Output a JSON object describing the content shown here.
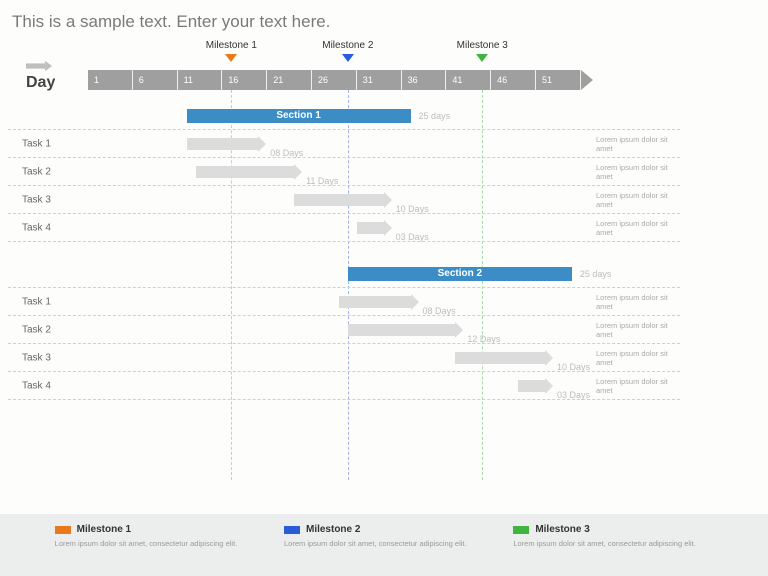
{
  "title": "This is a sample text. Enter your text here.",
  "day_label": "Day",
  "axis_ticks": [
    "1",
    "6",
    "11",
    "16",
    "21",
    "26",
    "31",
    "36",
    "41",
    "46",
    "51"
  ],
  "milestones": [
    {
      "label": "Milestone 1",
      "day": 17,
      "color": "#e87a1c"
    },
    {
      "label": "Milestone 2",
      "day": 30,
      "color": "#2a5bd8"
    },
    {
      "label": "Milestone 3",
      "day": 45,
      "color": "#3fb540"
    }
  ],
  "sections": [
    {
      "name": "Section 1",
      "start": 12,
      "duration": 25,
      "duration_label": "25 days",
      "tasks": [
        {
          "name": "Task 1",
          "start": 12,
          "duration": 8,
          "dur_label": "08 Days",
          "note": "Lorem ipsum dolor sit amet"
        },
        {
          "name": "Task 2",
          "start": 13,
          "duration": 11,
          "dur_label": "11 Days",
          "note": "Lorem ipsum dolor sit amet"
        },
        {
          "name": "Task 3",
          "start": 24,
          "duration": 10,
          "dur_label": "10 Days",
          "note": "Lorem ipsum dolor sit amet"
        },
        {
          "name": "Task 4",
          "start": 31,
          "duration": 3,
          "dur_label": "03 Days",
          "note": "Lorem ipsum dolor sit amet"
        }
      ]
    },
    {
      "name": "Section 2",
      "start": 30,
      "duration": 25,
      "duration_label": "25 days",
      "tasks": [
        {
          "name": "Task 1",
          "start": 29,
          "duration": 8,
          "dur_label": "08 Days",
          "note": "Lorem ipsum dolor sit amet"
        },
        {
          "name": "Task 2",
          "start": 30,
          "duration": 12,
          "dur_label": "12 Days",
          "note": "Lorem ipsum dolor sit amet"
        },
        {
          "name": "Task 3",
          "start": 42,
          "duration": 10,
          "dur_label": "10 Days",
          "note": "Lorem ipsum dolor sit amet"
        },
        {
          "name": "Task 4",
          "start": 49,
          "duration": 3,
          "dur_label": "03 Days",
          "note": "Lorem ipsum dolor sit amet"
        }
      ]
    }
  ],
  "legend": [
    {
      "name": "Milestone 1",
      "color": "#e87a1c",
      "desc": "Lorem ipsum dolor sit amet, consectetur adipiscing elit."
    },
    {
      "name": "Milestone 2",
      "color": "#2a5bd8",
      "desc": "Lorem ipsum dolor sit amet, consectetur adipiscing elit."
    },
    {
      "name": "Milestone 3",
      "color": "#3fb540",
      "desc": "Lorem ipsum dolor sit amet, consectetur adipiscing elit."
    }
  ],
  "chart_data": {
    "type": "gantt",
    "x_unit": "day",
    "x_range": [
      1,
      55
    ],
    "milestones": [
      {
        "name": "Milestone 1",
        "day": 17
      },
      {
        "name": "Milestone 2",
        "day": 30
      },
      {
        "name": "Milestone 3",
        "day": 45
      }
    ],
    "sections": [
      {
        "name": "Section 1",
        "start": 12,
        "duration": 25,
        "tasks": [
          {
            "name": "Task 1",
            "start": 12,
            "duration": 8
          },
          {
            "name": "Task 2",
            "start": 13,
            "duration": 11
          },
          {
            "name": "Task 3",
            "start": 24,
            "duration": 10
          },
          {
            "name": "Task 4",
            "start": 31,
            "duration": 3
          }
        ]
      },
      {
        "name": "Section 2",
        "start": 30,
        "duration": 25,
        "tasks": [
          {
            "name": "Task 1",
            "start": 29,
            "duration": 8
          },
          {
            "name": "Task 2",
            "start": 30,
            "duration": 12
          },
          {
            "name": "Task 3",
            "start": 42,
            "duration": 10
          },
          {
            "name": "Task 4",
            "start": 49,
            "duration": 3
          }
        ]
      }
    ]
  }
}
